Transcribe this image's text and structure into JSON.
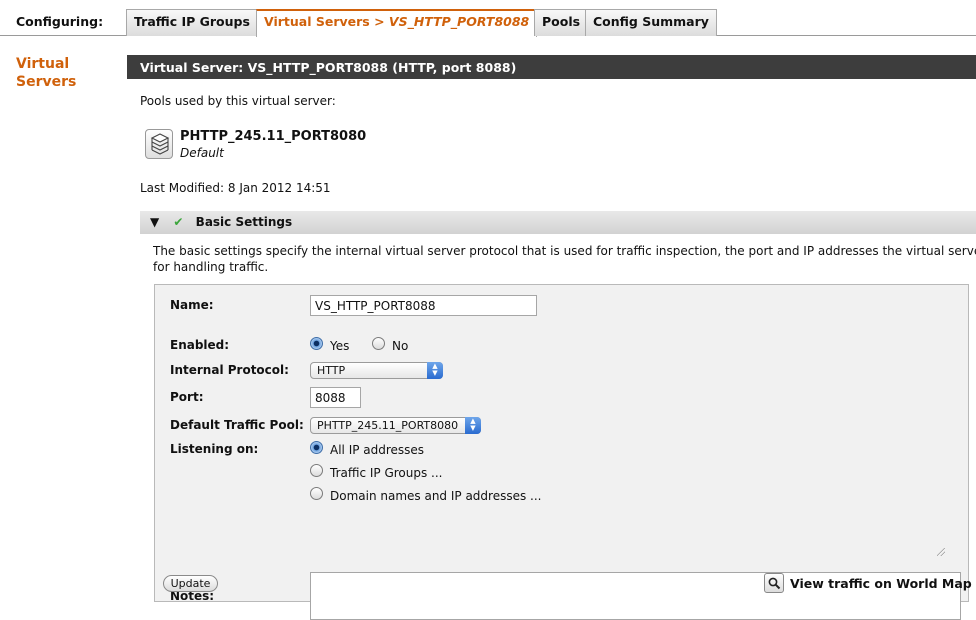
{
  "header": {
    "configuring_label": "Configuring:",
    "tabs": [
      {
        "label": "Traffic IP Groups"
      },
      {
        "label": "Virtual Servers >",
        "crumb": "VS_HTTP_PORT8088"
      },
      {
        "label": "Pools"
      },
      {
        "label": "Config Summary"
      }
    ]
  },
  "leftnav": {
    "line1": "Virtual",
    "line2": "Servers"
  },
  "main": {
    "title": "Virtual Server: VS_HTTP_PORT8088 (HTTP, port 8088)",
    "pools_used_label": "Pools used by this virtual server:",
    "pool": {
      "name": "PHTTP_245.11_PORT8080",
      "subtitle": "Default"
    },
    "last_modified": "Last Modified: 8 Jan 2012 14:51"
  },
  "section": {
    "title": "Basic Settings",
    "desc_line1": "The basic settings specify the internal virtual server protocol that is used for traffic inspection, the port and IP addresses the virtual server",
    "desc_line2": "for handling traffic."
  },
  "form": {
    "name_label": "Name:",
    "name_value": "VS_HTTP_PORT8088",
    "enabled_label": "Enabled:",
    "enabled_yes": "Yes",
    "enabled_no": "No",
    "protocol_label": "Internal Protocol:",
    "protocol_value": "HTTP",
    "port_label": "Port:",
    "port_value": "8088",
    "pool_label": "Default Traffic Pool:",
    "pool_value": "PHTTP_245.11_PORT8080",
    "listening_label": "Listening on:",
    "listen_options": [
      "All IP addresses",
      "Traffic IP Groups ...",
      "Domain names and IP addresses ..."
    ],
    "notes_label": "Notes:",
    "notes_value": ""
  },
  "footer": {
    "update_label": "Update",
    "map_label": "View traffic on World Map"
  },
  "colors": {
    "accent": "#d0610b",
    "header_bg": "#3d3d3d",
    "check": "#3aa53a"
  }
}
